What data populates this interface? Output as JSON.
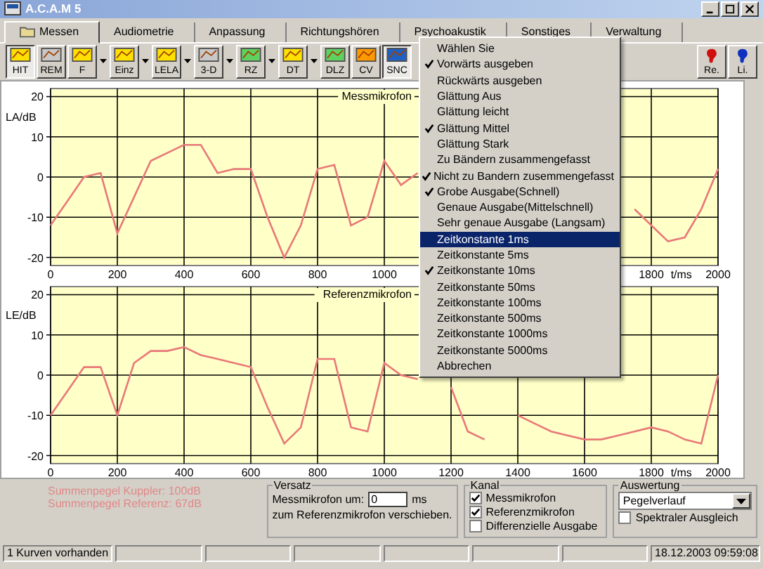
{
  "window": {
    "title": "A.C.A.M 5"
  },
  "tabs": [
    {
      "label": "Messen",
      "selected": true
    },
    {
      "label": "Audiometrie",
      "selected": false
    },
    {
      "label": "Anpassung",
      "selected": false
    },
    {
      "label": "Richtungshören",
      "selected": false
    },
    {
      "label": "Psychoakustik",
      "selected": false
    },
    {
      "label": "Sonstiges",
      "selected": false
    },
    {
      "label": "Verwaltung",
      "selected": false
    }
  ],
  "toolbar": [
    {
      "label": "HIT",
      "pressed": true,
      "has_menu": false
    },
    {
      "label": "REM",
      "pressed": false,
      "has_menu": false
    },
    {
      "label": "F",
      "pressed": false,
      "has_menu": true
    },
    {
      "label": "Einz",
      "pressed": false,
      "has_menu": true
    },
    {
      "label": "LELA",
      "pressed": false,
      "has_menu": true
    },
    {
      "label": "3-D",
      "pressed": false,
      "has_menu": true
    },
    {
      "label": "RZ",
      "pressed": false,
      "has_menu": true
    },
    {
      "label": "DT",
      "pressed": false,
      "has_menu": true
    },
    {
      "label": "DLZ",
      "pressed": false,
      "has_menu": false
    },
    {
      "label": "CV",
      "pressed": false,
      "has_menu": false
    },
    {
      "label": "SNC",
      "pressed": true,
      "has_menu": false
    }
  ],
  "toolbar_right": [
    {
      "label": "Re.",
      "color": "#d01010"
    },
    {
      "label": "Li.",
      "color": "#1030c0"
    }
  ],
  "menu": [
    {
      "label": "Wählen Sie",
      "checked": false,
      "selected": false
    },
    {
      "label": "Vorwärts ausgeben",
      "checked": true,
      "selected": false
    },
    {
      "label": "Rückwärts ausgeben",
      "checked": false,
      "selected": false
    },
    {
      "label": "Glättung Aus",
      "checked": false,
      "selected": false
    },
    {
      "label": "Glättung leicht",
      "checked": false,
      "selected": false
    },
    {
      "label": "Glättung Mittel",
      "checked": true,
      "selected": false
    },
    {
      "label": "Glättung Stark",
      "checked": false,
      "selected": false
    },
    {
      "label": "Zu Bändern zusammengefasst",
      "checked": false,
      "selected": false
    },
    {
      "label": "Nicht zu Bandern zusemmengefasst",
      "checked": true,
      "selected": false
    },
    {
      "label": "Grobe Ausgabe(Schnell)",
      "checked": true,
      "selected": false
    },
    {
      "label": "Genaue Ausgabe(Mittelschnell)",
      "checked": false,
      "selected": false
    },
    {
      "label": "Sehr genaue Ausgabe (Langsam)",
      "checked": false,
      "selected": false
    },
    {
      "label": "Zeitkonstante 1ms",
      "checked": false,
      "selected": true
    },
    {
      "label": "Zeitkonstante 5ms",
      "checked": false,
      "selected": false
    },
    {
      "label": "Zeitkonstante 10ms",
      "checked": true,
      "selected": false
    },
    {
      "label": "Zeitkonstante 50ms",
      "checked": false,
      "selected": false
    },
    {
      "label": "Zeitkonstante 100ms",
      "checked": false,
      "selected": false
    },
    {
      "label": "Zeitkonstante 500ms",
      "checked": false,
      "selected": false
    },
    {
      "label": "Zeitkonstante 1000ms",
      "checked": false,
      "selected": false
    },
    {
      "label": "Zeitkonstante 5000ms",
      "checked": false,
      "selected": false
    },
    {
      "label": "Abbrechen",
      "checked": false,
      "selected": false
    }
  ],
  "charts": [
    {
      "chart_data": {
        "type": "line",
        "title": "Messmikrofon",
        "xlabel": "t/ms",
        "ylabel": "LA/dB",
        "grid": true,
        "x": [
          0,
          50,
          100,
          150,
          200,
          250,
          300,
          350,
          400,
          450,
          500,
          550,
          600,
          650,
          700,
          750,
          800,
          850,
          900,
          950,
          1000,
          1050,
          1100,
          1750,
          1800,
          1850,
          1900,
          1950,
          2000
        ],
        "series": [
          {
            "color": "#e87878",
            "values": [
              -12,
              -6,
              0,
              1,
              -14,
              -5,
              4,
              6,
              8,
              8,
              1,
              2,
              2,
              -10,
              -20,
              -12,
              2,
              3,
              -12,
              -10,
              4,
              -2,
              1,
              -8,
              -12,
              -16,
              -15,
              -8,
              2
            ]
          }
        ],
        "xlim": [
          0,
          2000
        ],
        "ylim": [
          -22,
          22
        ],
        "xticks": [
          0,
          200,
          400,
          600,
          800,
          1000,
          1800,
          2000
        ],
        "yticks": [
          -20,
          -10,
          0,
          10,
          20
        ]
      }
    },
    {
      "chart_data": {
        "type": "line",
        "title": "Referenzmikrofon",
        "xlabel": "t/ms",
        "ylabel": "LE/dB",
        "grid": true,
        "x": [
          0,
          50,
          100,
          150,
          200,
          250,
          300,
          350,
          400,
          450,
          500,
          550,
          600,
          650,
          700,
          750,
          800,
          850,
          900,
          950,
          1000,
          1050,
          1100,
          1150,
          1200,
          1250,
          1300,
          1350,
          1400,
          1450,
          1500,
          1550,
          1600,
          1650,
          1700,
          1750,
          1800,
          1850,
          1900,
          1950,
          2000
        ],
        "series": [
          {
            "color": "#e87878",
            "values": [
              -10,
              -4,
              2,
              2,
              -10,
              3,
              6,
              6,
              7,
              5,
              4,
              3,
              2,
              -8,
              -17,
              -13,
              4,
              4,
              -13,
              -14,
              3,
              0,
              -1,
              null,
              -3,
              -14,
              -16,
              null,
              -10,
              -12,
              -14,
              -15,
              -16,
              -16,
              -15,
              -14,
              -13,
              -14,
              -16,
              -17,
              0
            ]
          }
        ],
        "xlim": [
          0,
          2000
        ],
        "ylim": [
          -22,
          22
        ],
        "xticks": [
          0,
          200,
          400,
          600,
          800,
          1000,
          1200,
          1400,
          1600,
          1800,
          2000
        ],
        "yticks": [
          -20,
          -10,
          0,
          10,
          20
        ]
      }
    }
  ],
  "summary": [
    "Summenpegel Kuppler: 100dB",
    "Summenpegel Referenz: 67dB"
  ],
  "versatz": {
    "title": "Versatz",
    "label": "Messmikrofon um:",
    "value": "0",
    "unit": "ms",
    "note": "zum Referenzmikrofon verschieben."
  },
  "kanal": {
    "title": "Kanal",
    "options": [
      {
        "label": "Messmikrofon",
        "checked": true
      },
      {
        "label": "Referenzmikrofon",
        "checked": true
      },
      {
        "label": "Differenzielle Ausgabe",
        "checked": false
      }
    ]
  },
  "auswertung": {
    "title": "Auswertung",
    "value": "Pegelverlauf",
    "option": {
      "label": "Spektraler Ausgleich",
      "checked": false
    }
  },
  "status_bar": {
    "left": "1 Kurven vorhanden",
    "right": "18.12.2003 09:59:08"
  }
}
